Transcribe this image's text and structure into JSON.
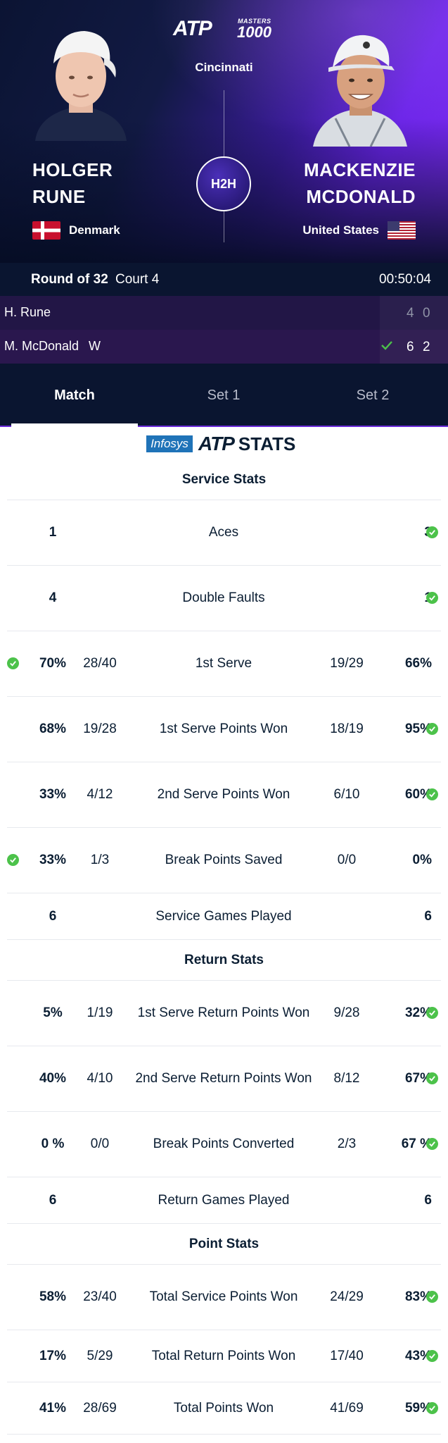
{
  "header": {
    "logo_atp": "ATP",
    "logo_masters": "MASTERS",
    "logo_1000": "1000",
    "tournament": "Cincinnati",
    "h2h_label": "H2H"
  },
  "players": {
    "left": {
      "first": "HOLGER",
      "last": "RUNE",
      "country": "Denmark"
    },
    "right": {
      "first": "MACKENZIE",
      "last": "MCDONALD",
      "country": "United States"
    }
  },
  "match_info": {
    "round": "Round of 32",
    "court": "Court 4",
    "duration": "00:50:04"
  },
  "scoreboard": [
    {
      "name": "H. Rune",
      "winner_mark": "",
      "sets": [
        "4",
        "0"
      ]
    },
    {
      "name": "M. McDonald",
      "winner_mark": "W",
      "sets": [
        "6",
        "2"
      ]
    }
  ],
  "tabs": [
    "Match",
    "Set 1",
    "Set 2"
  ],
  "stats_logo": {
    "infosys": "Infosys",
    "atp": "ATP",
    "stats": "STATS"
  },
  "colors": {
    "check": "#4cc24a",
    "tab_underline": "#6a2bd9",
    "infosys": "#1f73b8"
  },
  "sections": {
    "service": {
      "title": "Service Stats",
      "rows": [
        {
          "label": "Aces",
          "l_pct": "1",
          "l_raw": "",
          "r_raw": "",
          "r_pct": "3"
        },
        {
          "label": "Double Faults",
          "l_pct": "4",
          "l_raw": "",
          "r_raw": "",
          "r_pct": "1"
        },
        {
          "label": "1st Serve",
          "l_pct": "70%",
          "l_raw": "28/40",
          "r_raw": "19/29",
          "r_pct": "66%"
        },
        {
          "label": "1st Serve Points Won",
          "l_pct": "68%",
          "l_raw": "19/28",
          "r_raw": "18/19",
          "r_pct": "95%"
        },
        {
          "label": "2nd Serve Points Won",
          "l_pct": "33%",
          "l_raw": "4/12",
          "r_raw": "6/10",
          "r_pct": "60%"
        },
        {
          "label": "Break Points Saved",
          "l_pct": "33%",
          "l_raw": "1/3",
          "r_raw": "0/0",
          "r_pct": "0%"
        },
        {
          "label": "Service Games Played",
          "l_pct": "6",
          "l_raw": "",
          "r_raw": "",
          "r_pct": "6"
        }
      ]
    },
    "return": {
      "title": "Return Stats",
      "rows": [
        {
          "label": "1st Serve Return Points Won",
          "l_pct": "5%",
          "l_raw": "1/19",
          "r_raw": "9/28",
          "r_pct": "32%"
        },
        {
          "label": "2nd Serve Return Points Won",
          "l_pct": "40%",
          "l_raw": "4/10",
          "r_raw": "8/12",
          "r_pct": "67%"
        },
        {
          "label": "Break Points Converted",
          "l_pct": "0 %",
          "l_raw": "0/0",
          "r_raw": "2/3",
          "r_pct": "67 %"
        },
        {
          "label": "Return Games Played",
          "l_pct": "6",
          "l_raw": "",
          "r_raw": "",
          "r_pct": "6"
        }
      ]
    },
    "point": {
      "title": "Point Stats",
      "rows": [
        {
          "label": "Total Service Points Won",
          "l_pct": "58%",
          "l_raw": "23/40",
          "r_raw": "24/29",
          "r_pct": "83%"
        },
        {
          "label": "Total Return Points Won",
          "l_pct": "17%",
          "l_raw": "5/29",
          "r_raw": "17/40",
          "r_pct": "43%"
        },
        {
          "label": "Total Points Won",
          "l_pct": "41%",
          "l_raw": "28/69",
          "r_raw": "41/69",
          "r_pct": "59%"
        }
      ]
    }
  }
}
